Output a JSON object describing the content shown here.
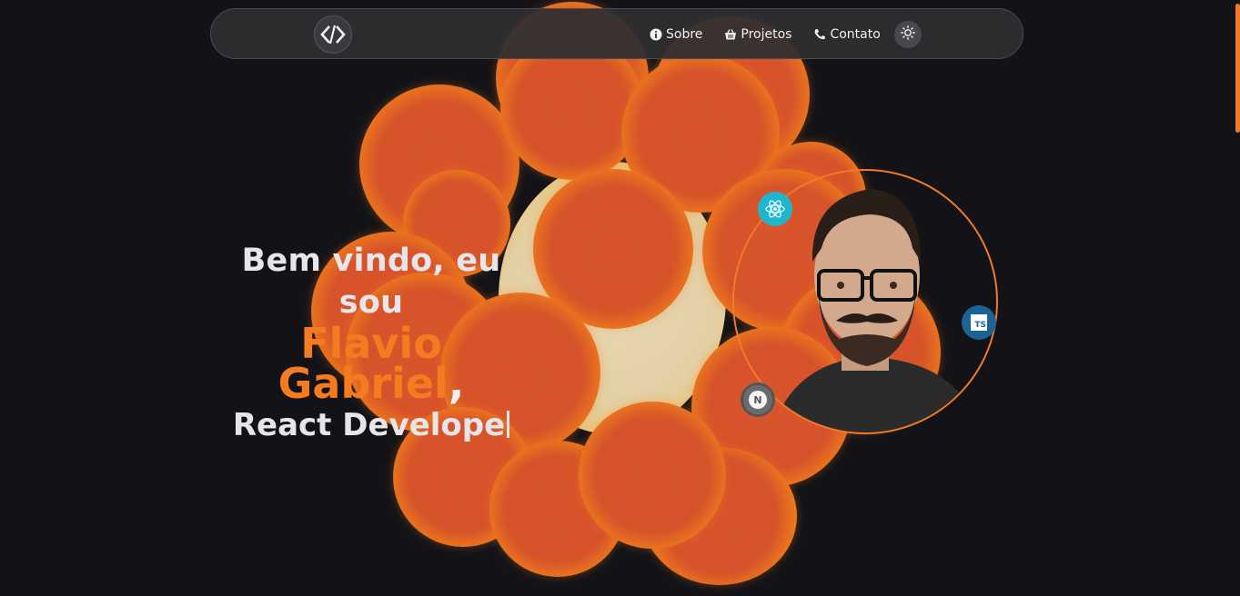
{
  "nav": {
    "items": [
      {
        "label": "Sobre",
        "icon": "info-icon"
      },
      {
        "label": "Projetos",
        "icon": "basket-icon"
      },
      {
        "label": "Contato",
        "icon": "phone-icon"
      }
    ],
    "theme_toggle_icon": "sun-icon",
    "logo_icon": "code-brackets-logo"
  },
  "hero": {
    "greeting": "Bem vindo, eu sou",
    "name": "Flavio Gabriel",
    "name_suffix": ",",
    "role": "React Develope"
  },
  "badges": {
    "react_icon": "react-icon",
    "ts_label": "TS",
    "next_label": "N"
  },
  "colors": {
    "accent": "#f47b20",
    "background": "#131317",
    "navbar": "#2e2e32"
  }
}
